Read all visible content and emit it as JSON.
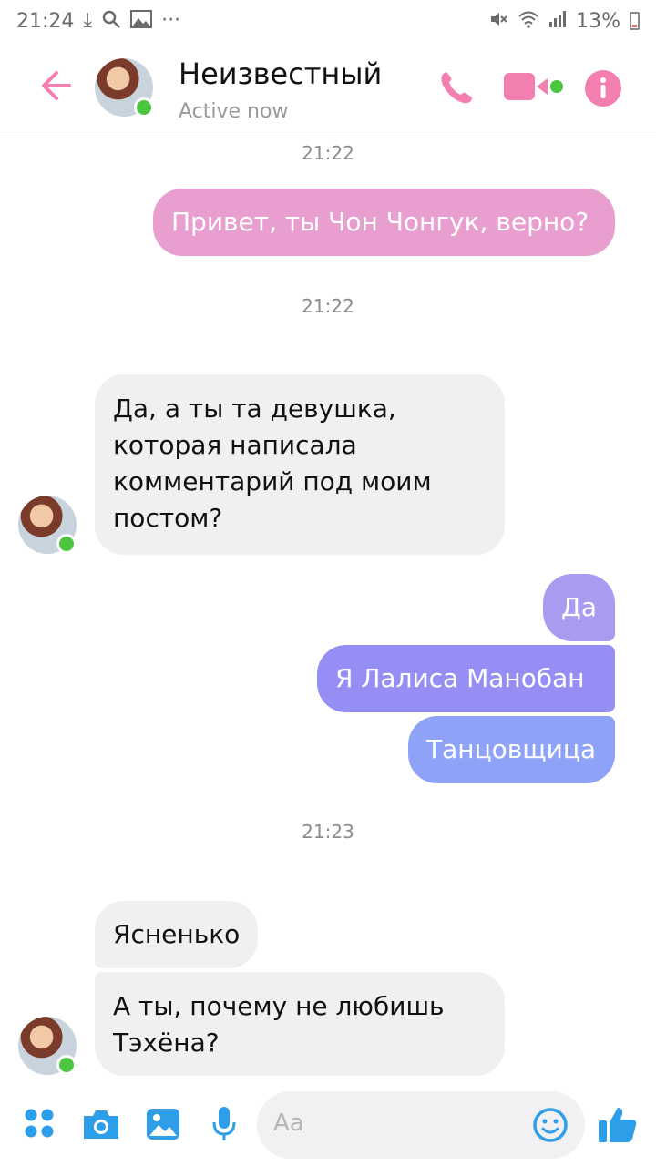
{
  "status_bar": {
    "time": "21:24",
    "battery": "13%"
  },
  "header": {
    "name": "Неизвестный",
    "status": "Active now"
  },
  "colors": {
    "accent_pink": "#f27fb0",
    "online_green": "#4cc640",
    "incoming_bg": "#f0f0f2",
    "out_pink": "#e89fd0",
    "out_purple": "#a79cf0",
    "out_violet": "#958ff5",
    "out_blue": "#8ea3f8",
    "icon_blue": "#2f9ee8"
  },
  "messages": {
    "ts1": "21:22",
    "out1": "Привет, ты Чон Чонгук, верно?",
    "ts2": "21:22",
    "in1": "Да, а ты та девушка,",
    "in1b": "которая написала",
    "in1c": "комментарий под моим",
    "in1d": "постом?",
    "out2": "Да",
    "out3": "Я Лалиса Манобан",
    "out4": "Танцовщица",
    "ts3": "21:23",
    "in2": "Ясненько",
    "in3": "А ты, почему не любишь",
    "in3b": "Тэхёна?"
  },
  "composer": {
    "placeholder": "Aa"
  },
  "icons": {
    "back": "back-arrow-icon",
    "call": "phone-icon",
    "video": "video-camera-icon",
    "info": "info-icon",
    "apps": "apps-dots-icon",
    "camera": "camera-icon",
    "gallery": "image-icon",
    "mic": "microphone-icon",
    "emoji": "emoji-icon",
    "like": "thumbs-up-icon"
  }
}
